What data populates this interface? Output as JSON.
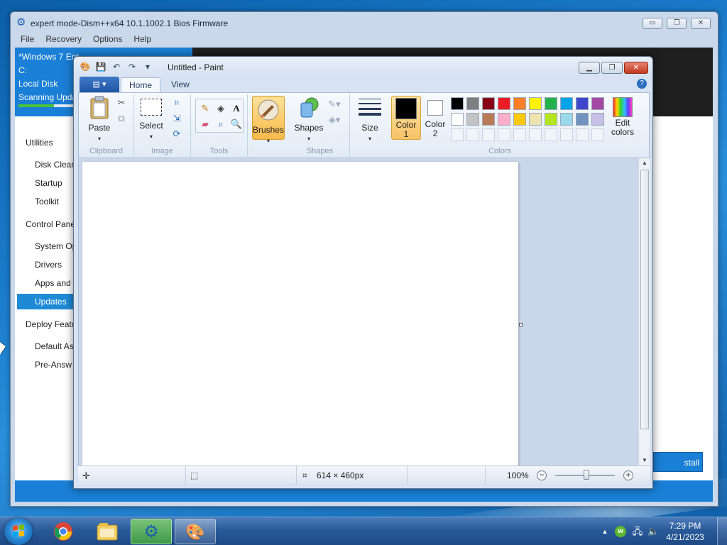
{
  "dism": {
    "title": "expert mode-Dism++x64 10.1.1002.1 Bios Firmware",
    "controls": {
      "minimize": "▭",
      "maximize": "❐",
      "close": "✕"
    },
    "menu": [
      "File",
      "Recovery",
      "Options",
      "Help"
    ],
    "session": {
      "os": "*Windows 7 Ent",
      "drive": "C:",
      "disk": "Local Disk",
      "status": "Scanning Upda",
      "progress_fraction": 0.62
    },
    "nav": {
      "groups": [
        "Utilities",
        "Control Pane",
        "Deploy Featu"
      ],
      "utilities": [
        "Disk Clean",
        "Startup",
        "Toolkit"
      ],
      "control_panel": [
        "System Op",
        "Drivers",
        "Apps and",
        "Updates"
      ],
      "deploy": [
        "Default As",
        "Pre-Answ"
      ]
    },
    "install_button": "stall Updates"
  },
  "paint": {
    "title": "Untitled - Paint",
    "tabs": [
      "Home",
      "View"
    ],
    "groups": {
      "clipboard": "Clipboard",
      "image": "Image",
      "tools": "Tools",
      "shapes": "Shapes",
      "colors": "Colors"
    },
    "buttons": {
      "paste": "Paste",
      "select": "Select",
      "brushes": "Brushes",
      "shapes": "Shapes",
      "size": "Size",
      "color1": "Color\n1",
      "color1_a": "Color",
      "color1_b": "1",
      "color2_a": "Color",
      "color2_b": "2",
      "edit_colors_a": "Edit",
      "edit_colors_b": "colors"
    },
    "color1_value": "#000000",
    "color2_value": "#ffffff",
    "palette_row1": [
      "#000000",
      "#7f7f7f",
      "#880015",
      "#ed1c24",
      "#ff7f27",
      "#fff200",
      "#22b14c",
      "#00a2e8",
      "#3f48cc",
      "#a349a4"
    ],
    "palette_row2": [
      "#ffffff",
      "#c3c3c3",
      "#b97a57",
      "#ffaec9",
      "#ffc90e",
      "#efe4b0",
      "#b5e61d",
      "#99d9ea",
      "#7092be",
      "#c8bfe7"
    ],
    "status": {
      "canvas_size": "614 × 460px",
      "zoom": "100%"
    }
  },
  "taskbar": {
    "time": "7:29 PM",
    "date": "4/21/2023",
    "apps": [
      "chrome-icon",
      "explorer-icon",
      "dism-icon",
      "paint-icon"
    ]
  }
}
